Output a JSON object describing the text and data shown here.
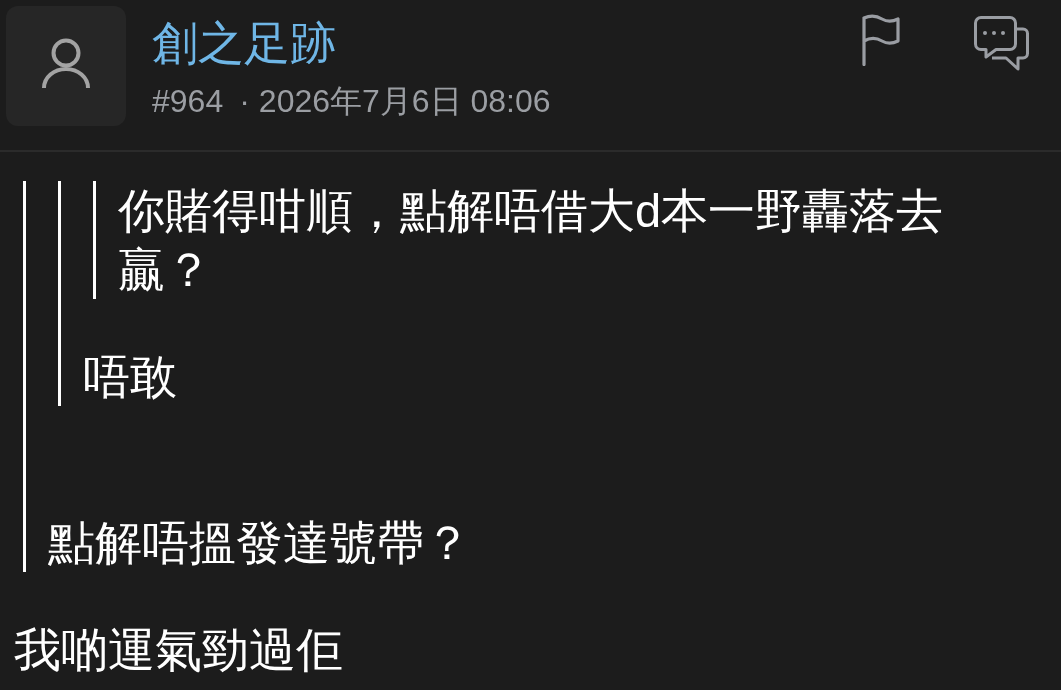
{
  "post": {
    "username": "創之足跡",
    "number": "#964",
    "separator": "·",
    "timestamp": "2026年7月6日 08:06"
  },
  "body": [
    {
      "kind": "quote",
      "children": [
        {
          "kind": "quote",
          "children": [
            {
              "kind": "quote",
              "children": [
                {
                  "kind": "text",
                  "text": "你賭得咁順，點解唔借大d本一野轟落去贏？"
                }
              ]
            },
            {
              "kind": "text",
              "text": "唔敢"
            }
          ]
        },
        {
          "kind": "text",
          "text": "點解唔搵發達號帶？"
        }
      ]
    },
    {
      "kind": "text",
      "text": "我啲運氣勁過佢"
    }
  ]
}
